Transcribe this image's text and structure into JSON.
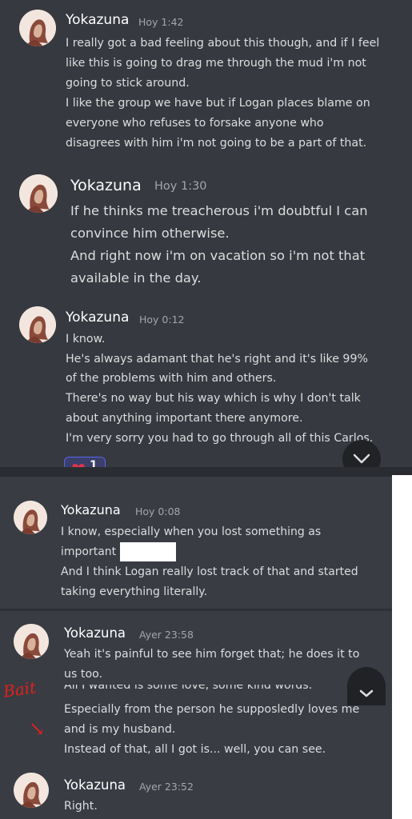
{
  "messages": [
    {
      "author": "Yokazuna",
      "time": "Hoy 1:42",
      "lines": [
        "I really got a bad feeling about this though, and if I feel",
        "like this is going to drag me through the mud i'm not",
        "going to stick around.",
        "I like the group we have but if Logan places blame on",
        "everyone who refuses to forsake anyone who",
        "disagrees with him i'm not going to be a part of that."
      ]
    },
    {
      "author": "Yokazuna",
      "time": "Hoy 1:30",
      "lines": [
        "If he thinks me treacherous i'm doubtful I can",
        "convince him otherwise.",
        "And right now i'm on vacation so i'm not that",
        "available in the day."
      ]
    },
    {
      "author": "Yokazuna",
      "time": "Hoy 0:12",
      "lines": [
        "I know.",
        "He's always adamant that he's right and it's like 99%",
        "of the problems with him and others.",
        "There's no way but his way which is why I don't talk",
        "about anything important there anymore.",
        "I'm very sorry you had to go through all of this Carlos."
      ],
      "reaction": {
        "emoji": "heart-icon",
        "count": "1"
      }
    },
    {
      "author": "Yokazuna",
      "time": "Hoy 0:08",
      "lines": [
        "I know, especially when you lost something as",
        "important",
        "And I think Logan really lost track of that and started",
        "taking everything literally."
      ]
    },
    {
      "author": "Yokazuna",
      "time": "Ayer 23:58",
      "lines": [
        "Yeah it's painful to see him forget that; he does it to",
        "us too."
      ]
    },
    {
      "author": "",
      "time": "",
      "lines": [
        "All I wanted is some love, some kind words.",
        "Especially from the person he supposledly loves me",
        "and is my husband.",
        "Instead of that, all I got is... well, you can see."
      ]
    },
    {
      "author": "Yokazuna",
      "time": "Ayer 23:52",
      "lines": [
        "Right."
      ]
    }
  ],
  "annotation": {
    "text": "Bait",
    "arrow": "↘"
  },
  "colors": {
    "background": "#36393f",
    "username": "#ffffff",
    "timestamp": "#a3a6aa",
    "message_text": "#dcddde",
    "reaction_bg": "#3b3f6a",
    "reaction_border": "#5865f2",
    "annotation": "#e3201c"
  }
}
